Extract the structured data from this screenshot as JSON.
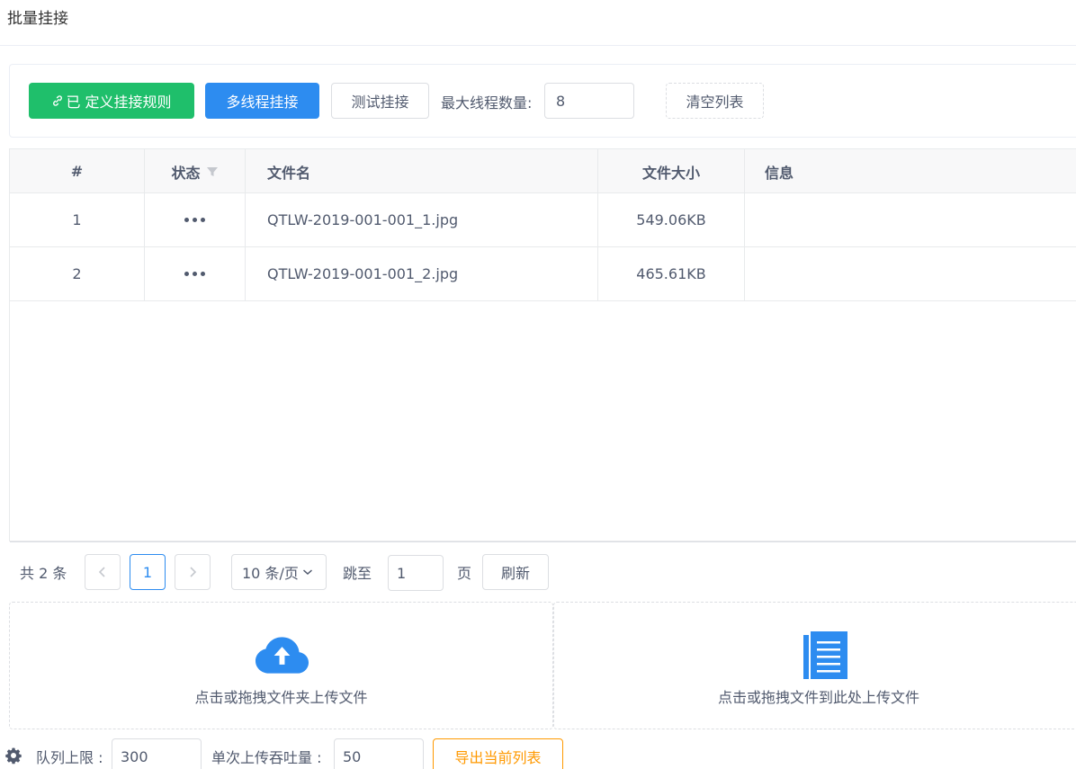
{
  "page": {
    "title": "批量挂接"
  },
  "toolbar": {
    "defined_rules_label": "已 定义挂接规则",
    "multithread_label": "多线程挂接",
    "test_label": "测试挂接",
    "max_threads_label": "最大线程数量:",
    "max_threads_value": "8",
    "clear_label": "清空列表"
  },
  "table": {
    "headers": {
      "index": "#",
      "status": "状态",
      "filename": "文件名",
      "size": "文件大小",
      "info": "信息"
    },
    "rows": [
      {
        "index": "1",
        "filename": "QTLW-2019-001-001_1.jpg",
        "size": "549.06KB",
        "info": ""
      },
      {
        "index": "2",
        "filename": "QTLW-2019-001-001_2.jpg",
        "size": "465.61KB",
        "info": ""
      }
    ]
  },
  "pager": {
    "total": "共 2 条",
    "current_page": "1",
    "page_size": "10 条/页",
    "jump_label": "跳至",
    "jump_value": "1",
    "page_suffix": "页",
    "refresh_label": "刷新"
  },
  "upload": {
    "folder_text": "点击或拖拽文件夹上传文件",
    "files_text": "点击或拖拽文件到此处上传文件"
  },
  "bottom": {
    "queue_limit_label": "队列上限 :",
    "queue_limit_value": "300",
    "throughput_label": "单次上传吞吐量 :",
    "throughput_value": "50",
    "export_label": "导出当前列表"
  },
  "colors": {
    "green": "#1fbf6b",
    "blue": "#2d8cf0",
    "orange": "#ff9900"
  }
}
